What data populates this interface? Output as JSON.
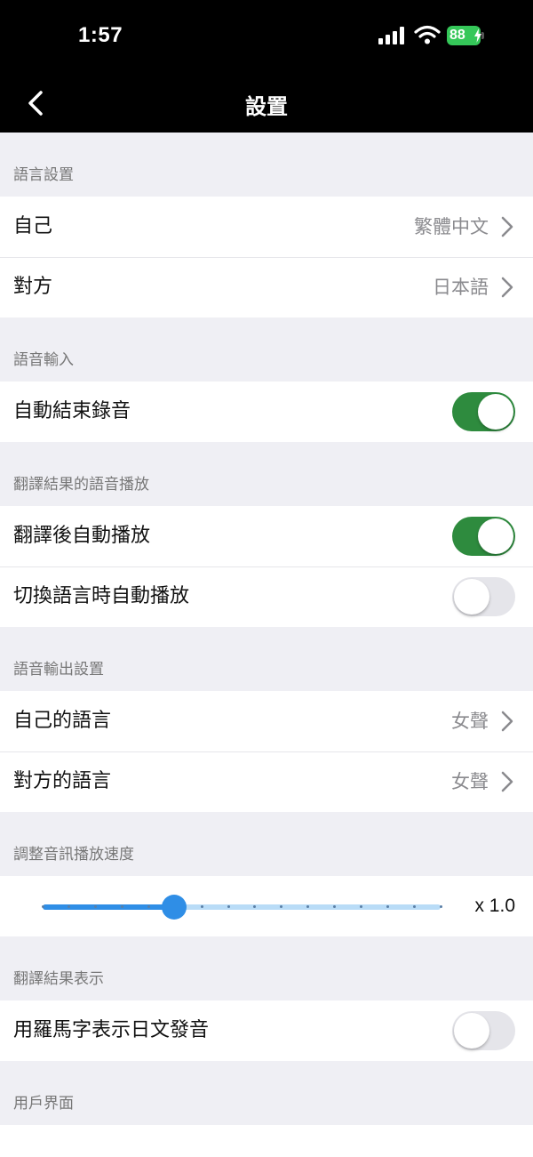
{
  "status_bar": {
    "time": "1:57",
    "battery": "88"
  },
  "nav": {
    "title": "設置"
  },
  "sections": {
    "language": {
      "header": "語言設置",
      "self_label": "自己",
      "self_value": "繁體中文",
      "other_label": "對方",
      "other_value": "日本語"
    },
    "voice_input": {
      "header": "語音輸入",
      "auto_stop_label": "自動結束錄音",
      "auto_stop_on": true
    },
    "playback": {
      "header": "翻譯結果的語音播放",
      "auto_play_label": "翻譯後自動播放",
      "auto_play_on": true,
      "switch_play_label": "切換語言時自動播放",
      "switch_play_on": false
    },
    "voice_output": {
      "header": "語音輸出設置",
      "self_label": "自己的語言",
      "self_value": "女聲",
      "other_label": "對方的語言",
      "other_value": "女聲"
    },
    "speed": {
      "header": "調整音訊播放速度",
      "value_label": "x 1.0",
      "slider_fraction": 0.33
    },
    "display": {
      "header": "翻譯結果表示",
      "romaji_label": "用羅馬字表示日文發音",
      "romaji_on": false
    },
    "ui": {
      "header": "用戶界面"
    }
  },
  "colors": {
    "accent_blue": "#2f8ee6",
    "toggle_on": "#2e8b3e",
    "battery": "#35c759"
  }
}
